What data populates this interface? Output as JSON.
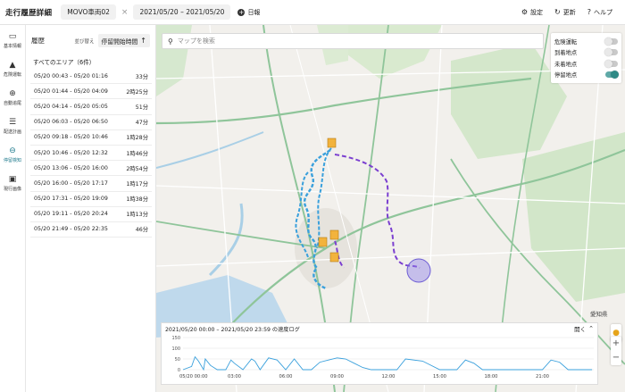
{
  "header": {
    "title": "走行履歴詳細",
    "vehicle_chip": "MOVO車両02",
    "close_icon": "×",
    "date_range": "2021/05/20 – 2021/05/20",
    "report_label": "日報",
    "actions": [
      {
        "icon": "gear-icon",
        "glyph": "⚙",
        "label": "設定"
      },
      {
        "icon": "refresh-icon",
        "glyph": "↻",
        "label": "更新"
      },
      {
        "icon": "help-icon",
        "glyph": "?",
        "label": "ヘルプ"
      }
    ]
  },
  "rail": {
    "items": [
      {
        "icon": "truck-icon",
        "glyph": "▭",
        "label": "基本情報"
      },
      {
        "icon": "warning-icon",
        "glyph": "▲",
        "label": "危険運転"
      },
      {
        "icon": "crosshair-icon",
        "glyph": "⊕",
        "label": "自動追尾"
      },
      {
        "icon": "list-icon",
        "glyph": "☰",
        "label": "配送計画"
      },
      {
        "icon": "stop-icon",
        "glyph": "⊖",
        "label": "停留検知"
      },
      {
        "icon": "image-icon",
        "glyph": "▣",
        "label": "現行画像"
      }
    ]
  },
  "history": {
    "title": "履歴",
    "sort_label": "並び替え",
    "sort_value": "停留開始時間",
    "sort_arrow": "↑",
    "area_label": "すべてのエリア（6件）",
    "rows": [
      {
        "range": "05/20 00:43 - 05/20 01:16",
        "duration": "33分"
      },
      {
        "range": "05/20 01:44 - 05/20 04:09",
        "duration": "2時25分"
      },
      {
        "range": "05/20 04:14 - 05/20 05:05",
        "duration": "51分"
      },
      {
        "range": "05/20 06:03 - 05/20 06:50",
        "duration": "47分"
      },
      {
        "range": "05/20 09:18 - 05/20 10:46",
        "duration": "1時28分"
      },
      {
        "range": "05/20 10:46 - 05/20 12:32",
        "duration": "1時46分"
      },
      {
        "range": "05/20 13:06 - 05/20 16:00",
        "duration": "2時54分"
      },
      {
        "range": "05/20 16:00 - 05/20 17:17",
        "duration": "1時17分"
      },
      {
        "range": "05/20 17:31 - 05/20 19:09",
        "duration": "1時38分"
      },
      {
        "range": "05/20 19:11 - 05/20 20:24",
        "duration": "1時13分"
      },
      {
        "range": "05/20 21:49 - 05/20 22:35",
        "duration": "46分"
      }
    ]
  },
  "map": {
    "search_placeholder": "マップを検索",
    "layers": [
      {
        "label": "危険運転",
        "on": false
      },
      {
        "label": "到着地点",
        "on": false
      },
      {
        "label": "未着地点",
        "on": false
      },
      {
        "label": "停留地点",
        "on": true
      }
    ],
    "labels": [
      "愛知県"
    ],
    "route_colors": {
      "light": "#3aa0dc",
      "dark": "#7b3fd0"
    },
    "zoom_in": "+",
    "zoom_out": "−",
    "pegman_icon": "person-icon"
  },
  "speed_log": {
    "title": "2021/05/20 00:00 – 2021/05/20 23:59 の速度ログ",
    "open_label": "開く",
    "y_ticks": [
      "150",
      "100",
      "50",
      "0"
    ],
    "x_ticks": [
      "05/20 00:00",
      "03:00",
      "06:00",
      "09:00",
      "12:00",
      "15:00",
      "18:00",
      "21:00"
    ],
    "chart_data": {
      "type": "line",
      "xlabel": "",
      "ylabel": "",
      "ylim": [
        0,
        150
      ],
      "x": [
        0,
        0.5,
        0.7,
        0.9,
        1.2,
        1.3,
        1.6,
        2.0,
        2.5,
        2.8,
        3.0,
        3.5,
        4.0,
        4.2,
        4.5,
        5.0,
        5.5,
        6.0,
        6.5,
        7.0,
        7.5,
        8.0,
        8.5,
        9.0,
        9.5,
        10.0,
        10.5,
        11.0,
        12.0,
        12.5,
        13.0,
        14.0,
        15.0,
        16.0,
        16.5,
        17.0,
        17.5,
        18.0,
        19.0,
        20.0,
        21.0,
        21.5,
        22.0,
        22.5,
        23.0,
        23.9
      ],
      "series": [
        {
          "values": [
            0,
            15,
            60,
            40,
            0,
            50,
            20,
            0,
            0,
            45,
            30,
            0,
            50,
            40,
            0,
            55,
            45,
            0,
            50,
            0,
            0,
            35,
            45,
            55,
            50,
            30,
            10,
            0,
            0,
            0,
            50,
            40,
            0,
            0,
            45,
            30,
            0,
            0,
            0,
            0,
            0,
            45,
            35,
            0,
            0,
            0
          ]
        }
      ]
    }
  }
}
